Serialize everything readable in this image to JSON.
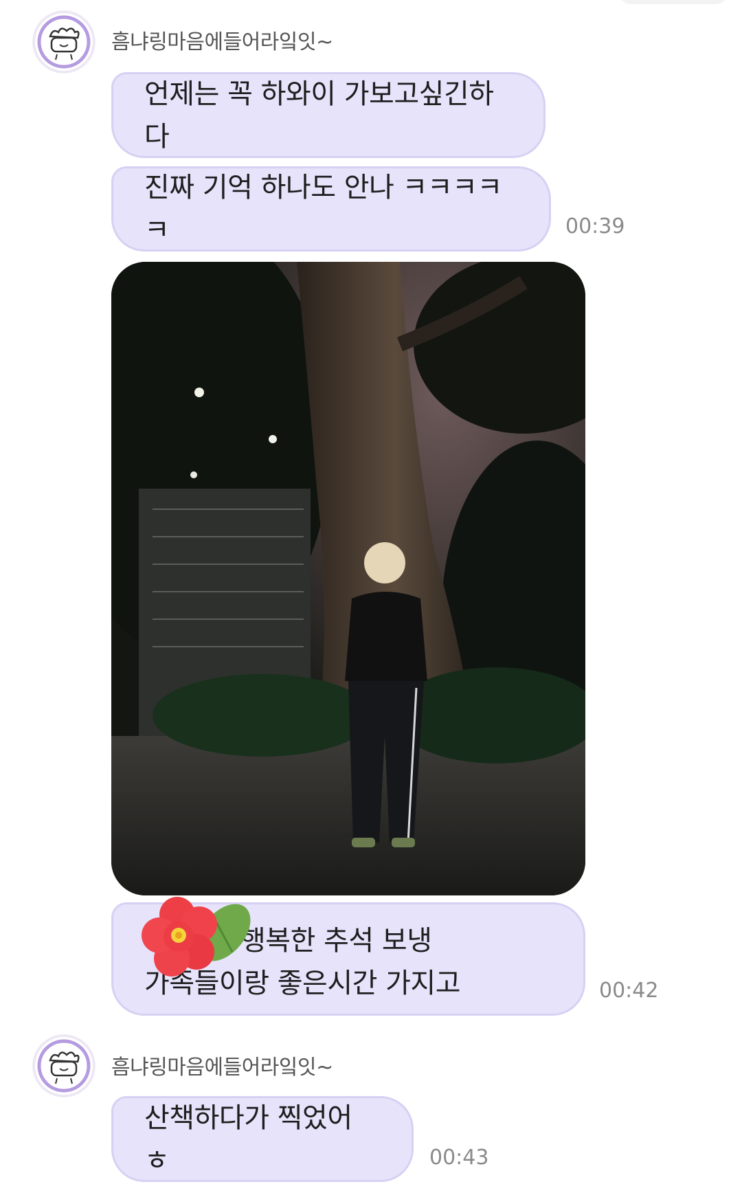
{
  "chat": {
    "sender_name": "흠냐링마음에들어라잌잇~",
    "group1": {
      "messages": [
        {
          "text": "언제는 꼭 하와이 가보고싶긴하다"
        },
        {
          "text": "진짜 기억 하나도 안나 ㅋㅋㅋㅋㅋ"
        }
      ],
      "time": "00:39"
    },
    "photo_message": {
      "caption_line1": "행복한 추석 보냉",
      "caption_line2": "가족들이랑 좋은시간 가지고",
      "time": "00:42"
    },
    "group2": {
      "message": "산책하다가 찍었어 ㅎ",
      "time": "00:43"
    }
  },
  "icons": {
    "avatar": "cartoon-muffin-avatar-icon",
    "sticker": "hibiscus-flower-sticker-icon"
  },
  "colors": {
    "bubble": "#e6e3fb",
    "bubble_border": "#d6d1f3",
    "avatar_ring": "#a78bd6",
    "time_text": "#8a8a8a",
    "flower": "#f0424a"
  }
}
